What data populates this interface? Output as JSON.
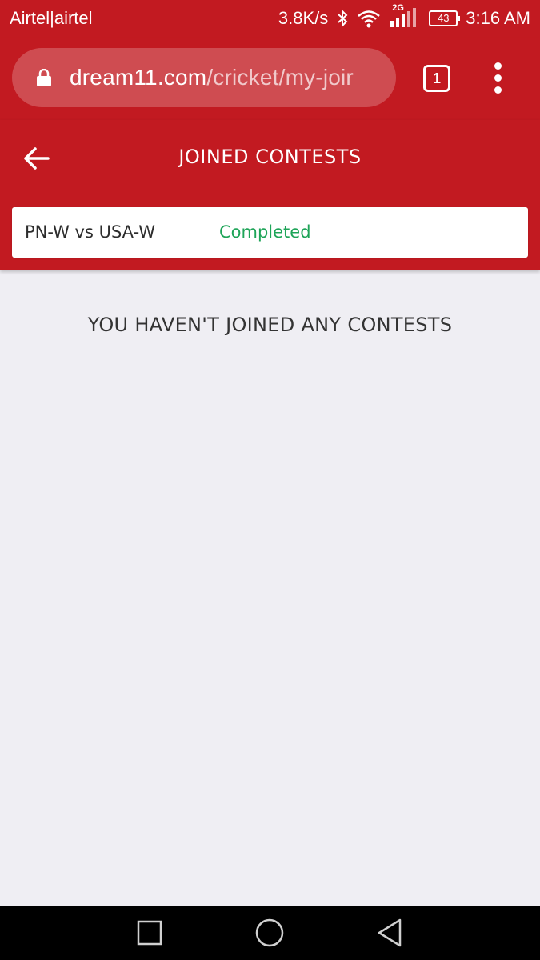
{
  "status_bar": {
    "carrier": "Airtel|airtel",
    "network_speed": "3.8K/s",
    "network_type": "2G",
    "battery_level": "43",
    "time": "3:16 AM"
  },
  "browser": {
    "url_domain": "dream11.com",
    "url_path": "/cricket/my-joir",
    "tab_count": "1"
  },
  "header": {
    "title": "JOINED CONTESTS"
  },
  "match": {
    "name": "PN-W vs USA-W",
    "status": "Completed"
  },
  "main": {
    "empty_message": "YOU HAVEN'T JOINED ANY CONTESTS"
  },
  "colors": {
    "brand_red": "#c21a21",
    "status_green": "#1ea458",
    "background": "#efeef3"
  }
}
